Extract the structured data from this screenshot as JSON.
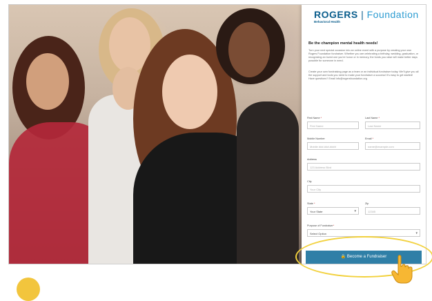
{
  "brand": {
    "rogers": "ROGERS",
    "separator": "|",
    "foundation": "Foundation",
    "subtitle": "Behavioral Health"
  },
  "form": {
    "headline": "Be the champion mental health needs!",
    "paragraph1": "Turn your next special occasion into an online event with a purpose by creating your own Rogers Foundation fundraiser. Whether you are celebrating a birthday, wedding, graduation, or recognizing an loved one you're honor or in memory, the funds you raise will make better days possible for someone in need.",
    "paragraph2": "Create your own fundraising page as a team or an individual fundraiser today. We'll give you all the support and tools you need to make your fundraiser a success! It's easy to get started! Have questions? Email info@rogersfoundation.org",
    "fields": {
      "first_name": {
        "label": "First Name",
        "placeholder": "First Name"
      },
      "last_name": {
        "label": "Last Name",
        "placeholder": "Last Name"
      },
      "mobile": {
        "label": "Mobile Number",
        "placeholder": "Mobile ###-###-####"
      },
      "email": {
        "label": "Email",
        "placeholder": "name@example.com"
      },
      "address": {
        "label": "Address",
        "placeholder": "123 Address Blvd"
      },
      "city": {
        "label": "City",
        "placeholder": "Your City"
      },
      "state": {
        "label": "State",
        "value": "Your State"
      },
      "zip": {
        "label": "Zip",
        "placeholder": "12345"
      },
      "purpose": {
        "label": "Purpose of Fundraiser",
        "value": "Select Option"
      }
    },
    "required_mark": "*",
    "cta_label": "🔒 Become a Fundraiser"
  },
  "colors": {
    "brand_blue": "#0a5d8c",
    "cta_blue": "#2f7fa7",
    "highlight_yellow": "#f2d13d"
  }
}
